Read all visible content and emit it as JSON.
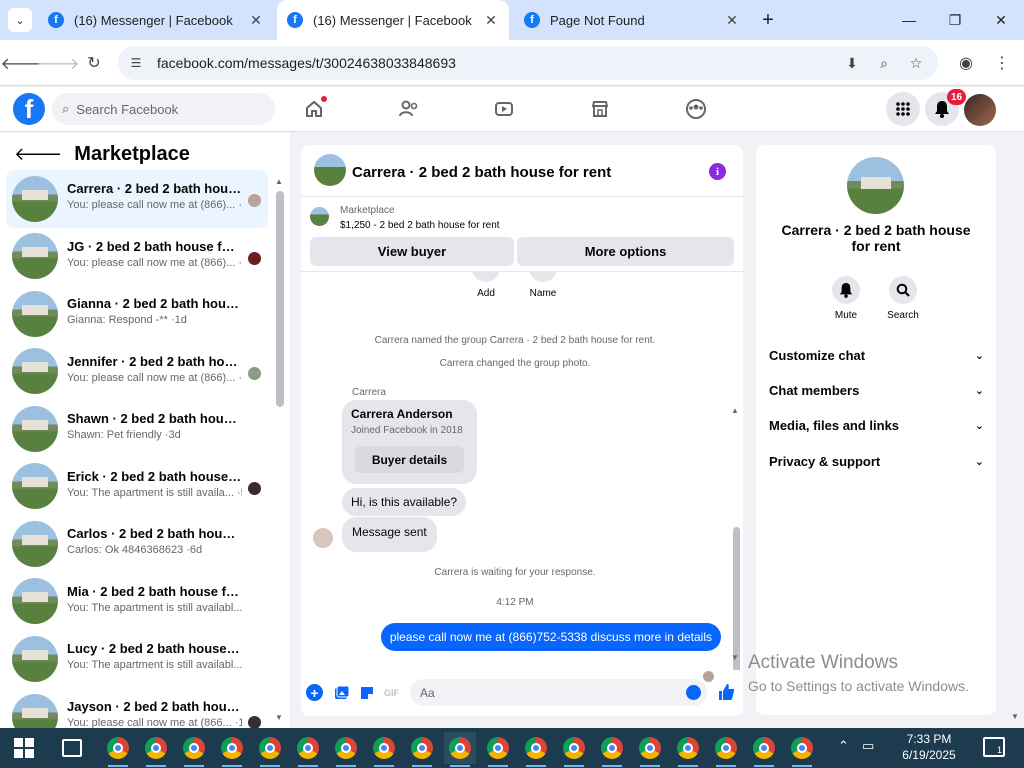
{
  "browser": {
    "tabs": [
      {
        "title": "(16) Messenger | Facebook",
        "active": false
      },
      {
        "title": "(16) Messenger | Facebook",
        "active": true
      },
      {
        "title": "Page Not Found",
        "active": false
      }
    ],
    "url": "facebook.com/messages/t/30024638033848693"
  },
  "fb_header": {
    "search_placeholder": "Search Facebook",
    "notification_count": "16"
  },
  "left": {
    "title": "Marketplace",
    "chats": [
      {
        "name": "Carrera · 2 bed 2 bath house ...",
        "preview": "You: please call now me at (866)... ·3h",
        "selected": true
      },
      {
        "name": "JG · 2 bed 2 bath house for re...",
        "preview": "You: please call now me at (866)... ·3h"
      },
      {
        "name": "Gianna · 2 bed 2 bath house for...",
        "preview": "Gianna: Respond -** ·1d"
      },
      {
        "name": "Jennifer · 2 bed 2 bath house ...",
        "preview": "You: please call now me at (866)... ·1d"
      },
      {
        "name": "Shawn · 2 bed 2 bath house for ...",
        "preview": "Shawn: Pet friendly ·3d"
      },
      {
        "name": "Erick · 2 bed 2 bath house for...",
        "preview": "You: The apartment is still availa... ·5d"
      },
      {
        "name": "Carlos · 2 bed 2 bath house for ...",
        "preview": "Carlos: Ok 4846368623 ·6d"
      },
      {
        "name": "Mia · 2 bed 2 bath house for rent",
        "preview": "You: The apartment is still availabl... ·1w"
      },
      {
        "name": "Lucy · 2 bed 2 bath house for rent",
        "preview": "You: The apartment is still availabl... ·1w"
      },
      {
        "name": "Jayson · 2 bed 2 bath house f...",
        "preview": "You: please call now me at (866... ·1w"
      }
    ]
  },
  "conversation": {
    "title": "Carrera · 2 bed 2 bath house for rent",
    "listing_label": "Marketplace",
    "listing_price": "$1,250 - 2 bed 2 bath house for rent",
    "view_buyer": "View buyer",
    "more_options": "More options",
    "add_label": "Add",
    "name_label": "Name",
    "sys1": "Carrera named the group Carrera · 2 bed 2 bath house for rent.",
    "sys2": "Carrera changed the group photo.",
    "sender": "Carrera",
    "profile_name": "Carrera Anderson",
    "profile_joined": "Joined Facebook in 2018",
    "buyer_details": "Buyer details",
    "msg1": "Hi, is this available?",
    "msg2": "Message sent",
    "waiting": "Carrera is waiting for your response.",
    "time": "4:12 PM",
    "out_msg": "please call now me at (866)752-5338 discuss more in details",
    "composer_placeholder": "Aa"
  },
  "right": {
    "title": "Carrera · 2 bed 2 bath house for rent",
    "mute": "Mute",
    "search": "Search",
    "sections": [
      "Customize chat",
      "Chat members",
      "Media, files and links",
      "Privacy & support"
    ]
  },
  "windows": {
    "activate_title": "Activate Windows",
    "activate_sub": "Go to Settings to activate Windows.",
    "time": "7:33 PM",
    "date": "6/19/2025",
    "notif": "1"
  }
}
